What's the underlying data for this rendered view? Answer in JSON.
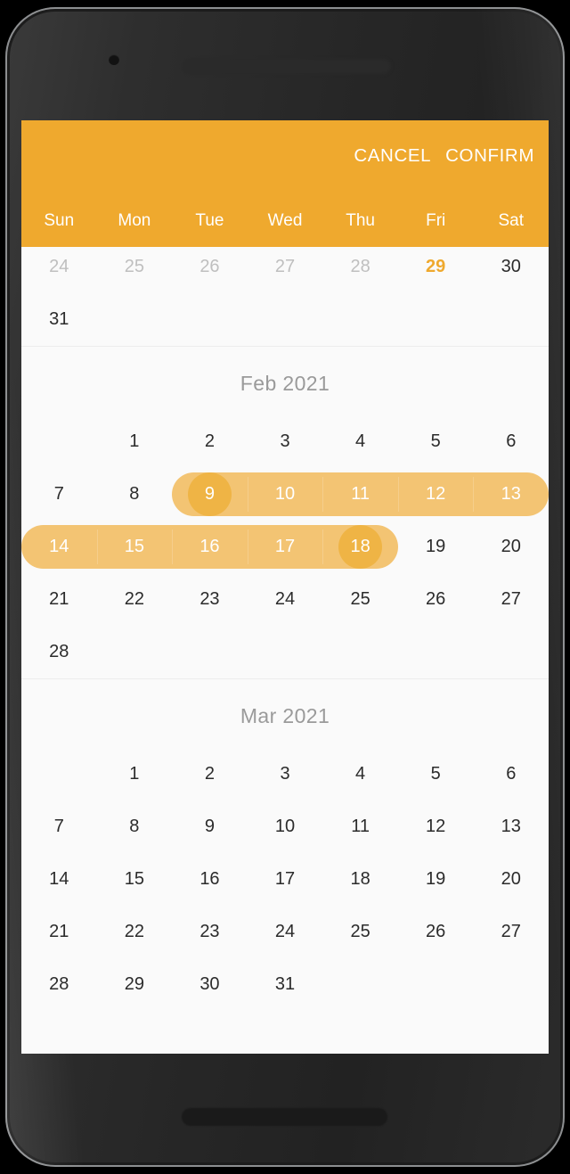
{
  "device": {
    "camera_icon": "camera-dot",
    "earpiece_icon": "earpiece-speaker",
    "bottom_speaker_icon": "bottom-speaker"
  },
  "colors": {
    "header_background": "#EFA92E",
    "range_fill": "#F3C473",
    "endpoint_fill": "#EFB445",
    "today_text": "#EFA92E",
    "screen_background": "#FAFAFA",
    "day_text": "#2B2B2B",
    "muted_day_text": "#BFBFBF",
    "month_title_text": "#9A9A9A",
    "divider": "#EDEDED"
  },
  "header": {
    "cancel_label": "CANCEL",
    "confirm_label": "CONFIRM",
    "weekdays": [
      "Sun",
      "Mon",
      "Tue",
      "Wed",
      "Thu",
      "Fri",
      "Sat"
    ]
  },
  "selection": {
    "start": "Feb 9, 2021",
    "end": "Feb 18, 2021"
  },
  "months": [
    {
      "title": "",
      "title_visible": false,
      "divider": false,
      "weeks": [
        [
          {
            "label": "24",
            "state": "muted"
          },
          {
            "label": "25",
            "state": "muted"
          },
          {
            "label": "26",
            "state": "muted"
          },
          {
            "label": "27",
            "state": "muted"
          },
          {
            "label": "28",
            "state": "muted"
          },
          {
            "label": "29",
            "state": "today"
          },
          {
            "label": "30",
            "state": "normal"
          }
        ],
        [
          {
            "label": "31",
            "state": "normal"
          },
          {
            "label": "",
            "state": "empty"
          },
          {
            "label": "",
            "state": "empty"
          },
          {
            "label": "",
            "state": "empty"
          },
          {
            "label": "",
            "state": "empty"
          },
          {
            "label": "",
            "state": "empty"
          },
          {
            "label": "",
            "state": "empty"
          }
        ]
      ]
    },
    {
      "title": "Feb 2021",
      "title_visible": true,
      "divider": true,
      "weeks": [
        [
          {
            "label": "",
            "state": "empty"
          },
          {
            "label": "1",
            "state": "normal"
          },
          {
            "label": "2",
            "state": "normal"
          },
          {
            "label": "3",
            "state": "normal"
          },
          {
            "label": "4",
            "state": "normal"
          },
          {
            "label": "5",
            "state": "normal"
          },
          {
            "label": "6",
            "state": "normal"
          }
        ],
        [
          {
            "label": "7",
            "state": "normal"
          },
          {
            "label": "8",
            "state": "normal"
          },
          {
            "label": "9",
            "state": "range-start"
          },
          {
            "label": "10",
            "state": "in-range"
          },
          {
            "label": "11",
            "state": "in-range"
          },
          {
            "label": "12",
            "state": "in-range"
          },
          {
            "label": "13",
            "state": "in-range"
          }
        ],
        [
          {
            "label": "14",
            "state": "in-range"
          },
          {
            "label": "15",
            "state": "in-range"
          },
          {
            "label": "16",
            "state": "in-range"
          },
          {
            "label": "17",
            "state": "in-range"
          },
          {
            "label": "18",
            "state": "range-end"
          },
          {
            "label": "19",
            "state": "normal"
          },
          {
            "label": "20",
            "state": "normal"
          }
        ],
        [
          {
            "label": "21",
            "state": "normal"
          },
          {
            "label": "22",
            "state": "normal"
          },
          {
            "label": "23",
            "state": "normal"
          },
          {
            "label": "24",
            "state": "normal"
          },
          {
            "label": "25",
            "state": "normal"
          },
          {
            "label": "26",
            "state": "normal"
          },
          {
            "label": "27",
            "state": "normal"
          }
        ],
        [
          {
            "label": "28",
            "state": "normal"
          },
          {
            "label": "",
            "state": "empty"
          },
          {
            "label": "",
            "state": "empty"
          },
          {
            "label": "",
            "state": "empty"
          },
          {
            "label": "",
            "state": "empty"
          },
          {
            "label": "",
            "state": "empty"
          },
          {
            "label": "",
            "state": "empty"
          }
        ]
      ]
    },
    {
      "title": "Mar 2021",
      "title_visible": true,
      "divider": true,
      "weeks": [
        [
          {
            "label": "",
            "state": "empty"
          },
          {
            "label": "1",
            "state": "normal"
          },
          {
            "label": "2",
            "state": "normal"
          },
          {
            "label": "3",
            "state": "normal"
          },
          {
            "label": "4",
            "state": "normal"
          },
          {
            "label": "5",
            "state": "normal"
          },
          {
            "label": "6",
            "state": "normal"
          }
        ],
        [
          {
            "label": "7",
            "state": "normal"
          },
          {
            "label": "8",
            "state": "normal"
          },
          {
            "label": "9",
            "state": "normal"
          },
          {
            "label": "10",
            "state": "normal"
          },
          {
            "label": "11",
            "state": "normal"
          },
          {
            "label": "12",
            "state": "normal"
          },
          {
            "label": "13",
            "state": "normal"
          }
        ],
        [
          {
            "label": "14",
            "state": "normal"
          },
          {
            "label": "15",
            "state": "normal"
          },
          {
            "label": "16",
            "state": "normal"
          },
          {
            "label": "17",
            "state": "normal"
          },
          {
            "label": "18",
            "state": "normal"
          },
          {
            "label": "19",
            "state": "normal"
          },
          {
            "label": "20",
            "state": "normal"
          }
        ],
        [
          {
            "label": "21",
            "state": "normal"
          },
          {
            "label": "22",
            "state": "normal"
          },
          {
            "label": "23",
            "state": "normal"
          },
          {
            "label": "24",
            "state": "normal"
          },
          {
            "label": "25",
            "state": "normal"
          },
          {
            "label": "26",
            "state": "normal"
          },
          {
            "label": "27",
            "state": "normal"
          }
        ],
        [
          {
            "label": "28",
            "state": "normal"
          },
          {
            "label": "29",
            "state": "normal"
          },
          {
            "label": "30",
            "state": "normal"
          },
          {
            "label": "31",
            "state": "normal"
          },
          {
            "label": "",
            "state": "empty"
          },
          {
            "label": "",
            "state": "empty"
          },
          {
            "label": "",
            "state": "empty"
          }
        ]
      ]
    }
  ]
}
